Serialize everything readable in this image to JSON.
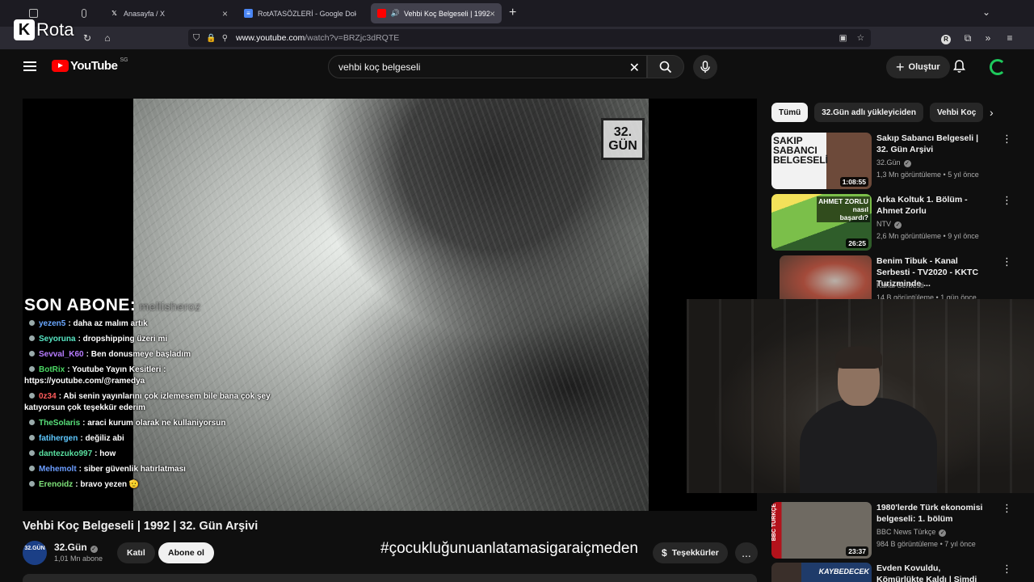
{
  "browser": {
    "tabs": [
      {
        "title": "",
        "favicon": "sidebar-icon"
      },
      {
        "title": "Anasayfa / X",
        "favicon": "x-logo"
      },
      {
        "title": "RotATASÖZLERİ - Google Doküm",
        "favicon": "docs-icon"
      },
      {
        "title": "Vehbi Koç Belgeseli | 1992 |",
        "favicon": "youtube-icon",
        "active": true
      }
    ],
    "new_tab": "+",
    "url_host": "www.youtube.com",
    "url_path": "/watch?v=BRZjc3dRQTE"
  },
  "overlay_logo": {
    "mark": "K",
    "word": "Rota"
  },
  "youtube": {
    "logo_text": "YouTube",
    "country": "SG",
    "search_value": "vehbi koç belgeseli",
    "create_label": "Oluştur"
  },
  "video": {
    "watermark": "32.\nGÜN",
    "title": "Vehbi Koç Belgeseli | 1992 | 32. Gün Arşivi",
    "channel": "32.Gün",
    "channel_avatar": "32.GÜN",
    "subscribers": "1,01 Mn abone",
    "join_label": "Katıl",
    "subscribe_label": "Abone ol",
    "thanks_label": "Teşekkürler",
    "more_label": "..."
  },
  "stream_overlay": {
    "last_sub_label": "SON ABONE:",
    "last_sub_name": "mellisheroz",
    "hashtag": "#çocukluğunuanlatamasigaraiçmeden",
    "chat": [
      {
        "user": "yezen5",
        "color": "#6aa7ff",
        "text": ": daha az malım artık"
      },
      {
        "user": "Seyoruna",
        "color": "#57e6c4",
        "text": ": dropshipping üzeri mi"
      },
      {
        "user": "Sevval_K60",
        "color": "#b77cff",
        "text": ": Ben donusmeye başladım"
      },
      {
        "user": "BotRix",
        "color": "#4cd964",
        "text": ": Youtube Yayın Kesitleri : https://youtube.com/@ramedya"
      },
      {
        "user": "0z34",
        "color": "#ff5b5b",
        "text": ": Abi senin yayınlarını çok izlemesem bile bana çok şey katıyorsun çok teşekkür ederim"
      },
      {
        "user": "TheSolaris",
        "color": "#58e07a",
        "text": ": araci kurum olarak ne kullaniyorsun"
      },
      {
        "user": "fatihergen",
        "color": "#5ec8ff",
        "text": ": değiliz abi"
      },
      {
        "user": "dantezuko997",
        "color": "#59e0a0",
        "text": ": how"
      },
      {
        "user": "Mehemolt",
        "color": "#6b9dff",
        "text": ": siber güvenlik hatırlatması"
      },
      {
        "user": "Erenoidz",
        "color": "#7fe37a",
        "text": ": bravo yezen 🫡"
      }
    ]
  },
  "sidebar": {
    "chips": [
      "Tümü",
      "32.Gün adlı yükleyiciden",
      "Vehbi Koç"
    ],
    "recommendations": [
      {
        "title": "Sakıp Sabancı Belgeseli | 32. Gün Arşivi",
        "channel": "32.Gün",
        "verified": true,
        "views": "1,3 Mn görüntüleme",
        "age": "5 yıl önce",
        "duration": "1:08:55",
        "thumb_text": "SAKIP\nSABANCI\nBELGESELİ"
      },
      {
        "title": "Arka Koltuk 1. Bölüm - Ahmet Zorlu",
        "channel": "NTV",
        "verified": true,
        "views": "2,6 Mn görüntüleme",
        "age": "9 yıl önce",
        "duration": "26:25",
        "thumb_text": "AHMET ZORLU\nnasıl\nbaşardı?"
      },
      {
        "title": "Benim Tibuk - Kanal Serbesti - TV2020 - KKTC Turizminde ...",
        "channel": "Kanal Serbesti",
        "verified": false,
        "views": "14 B görüntüleme",
        "age": "1 gün önce",
        "duration": "",
        "thumb_text": ""
      },
      {
        "title": "1980'lerde Türk ekonomisi belgeseli: 1. bölüm",
        "channel": "BBC News Türkçe",
        "verified": true,
        "views": "984 B görüntüleme",
        "age": "7 yıl önce",
        "duration": "23:37",
        "thumb_text": "BBC TÜRKÇE"
      },
      {
        "title": "Evden Kovuldu, Kömürlükte Kaldı | Şimdi Kendi Yaptığı",
        "channel": "",
        "verified": false,
        "views": "",
        "age": "",
        "duration": "",
        "thumb_text": "KAYBEDECEK"
      }
    ]
  }
}
